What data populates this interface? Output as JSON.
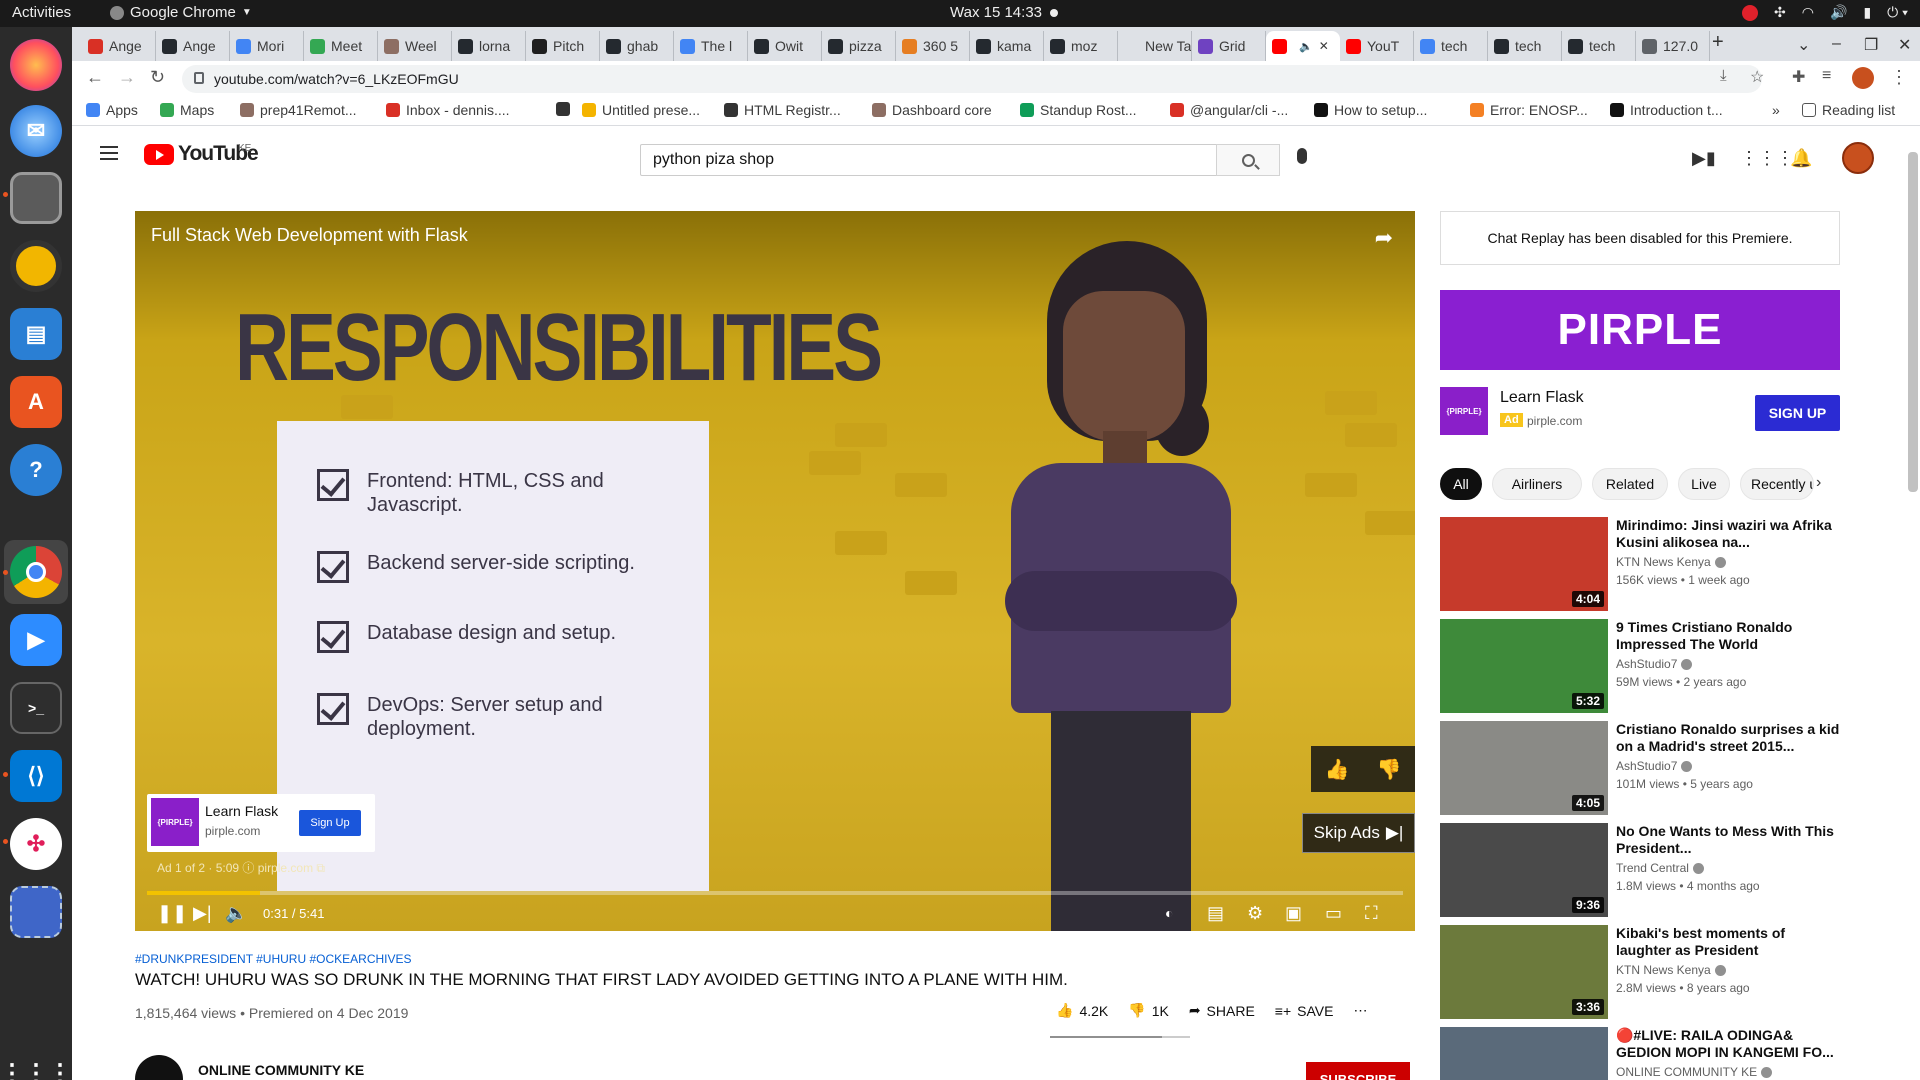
{
  "os": {
    "activities": "Activities",
    "app_name": "Google Chrome",
    "clock": "Wax 15  14:33"
  },
  "browser": {
    "tabs": [
      {
        "label": "Ange",
        "color": "#d93025"
      },
      {
        "label": "Ange",
        "color": "#24292f"
      },
      {
        "label": "Mori",
        "color": "#4285f4"
      },
      {
        "label": "Meet",
        "color": "#34a853"
      },
      {
        "label": "Weel",
        "color": "#8d6e63"
      },
      {
        "label": "lorna",
        "color": "#24292f"
      },
      {
        "label": "Pitch",
        "color": "#1f1f1f"
      },
      {
        "label": "ghab",
        "color": "#24292f"
      },
      {
        "label": "The l",
        "color": "#4285f4"
      },
      {
        "label": "Owit",
        "color": "#24292f"
      },
      {
        "label": "pizza",
        "color": "#24292f"
      },
      {
        "label": "360 5",
        "color": "#e67e22"
      },
      {
        "label": "kama",
        "color": "#24292f"
      },
      {
        "label": "moz",
        "color": "#24292f"
      },
      {
        "label": "New Tab",
        "color": "#dee1e6"
      },
      {
        "label": "Grid",
        "color": "#6f42c1"
      },
      {
        "label": "",
        "color": "#ff0000"
      },
      {
        "label": "YouT",
        "color": "#ff0000"
      },
      {
        "label": "tech",
        "color": "#4285f4"
      },
      {
        "label": "tech",
        "color": "#24292f"
      },
      {
        "label": "tech",
        "color": "#24292f"
      },
      {
        "label": "127.0",
        "color": "#5f6368"
      }
    ],
    "url": "youtube.com/watch?v=6_LKzEOFmGU",
    "bookmarks": [
      {
        "label": "Apps",
        "color": "#4285f4"
      },
      {
        "label": "Maps",
        "color": "#34a853"
      },
      {
        "label": "prep41Remot...",
        "color": "#8d6e63"
      },
      {
        "label": "Inbox - dennis....",
        "color": "#d93025"
      },
      {
        "label": "",
        "color": "#333333"
      },
      {
        "label": "Untitled prese...",
        "color": "#f4b400"
      },
      {
        "label": "HTML Registr...",
        "color": "#333333"
      },
      {
        "label": "Dashboard core",
        "color": "#8d6e63"
      },
      {
        "label": "Standup Rost...",
        "color": "#0f9d58"
      },
      {
        "label": "@angular/cli -...",
        "color": "#d93025"
      },
      {
        "label": "How to setup...",
        "color": "#111111"
      },
      {
        "label": "Error: ENOSP...",
        "color": "#f48024"
      },
      {
        "label": "Introduction t...",
        "color": "#111111"
      }
    ],
    "bookmarks_more": "»",
    "reading_list": "Reading list"
  },
  "youtube": {
    "logo_text": "YouTube",
    "country": "KE",
    "search_value": "python piza shop",
    "player": {
      "video_title": "Full Stack Web Development with Flask",
      "slide_heading": "RESPONSIBILITIES",
      "slide_items": [
        "Frontend: HTML, CSS and Javascript.",
        "Backend server-side scripting.",
        "Database design and setup.",
        "DevOps: Server setup and deployment."
      ],
      "ad_logo": "{PIRPLE}",
      "ad_title": "Learn Flask",
      "ad_domain": "pirple.com",
      "ad_button": "Sign Up",
      "ad_info": "Ad 1 of 2 · 5:09  ⓘ   pirple.com ⧉",
      "skip_label": "Skip Ads",
      "time": "0:31 / 5:41",
      "progress": 0.09
    },
    "video": {
      "hashtags": "#DRUNKPRESIDENT #UHURU #OCKEARCHIVES",
      "title": "WATCH! UHURU WAS SO DRUNK IN THE MORNING THAT FIRST LADY AVOIDED GETTING INTO A PLANE WITH HIM.",
      "meta": "1,815,464 views • Premiered on 4 Dec 2019",
      "likes": "4.2K",
      "dislikes": "1K",
      "share": "SHARE",
      "save": "SAVE",
      "like_ratio": 0.8,
      "channel": "ONLINE COMMUNITY KE",
      "subscribe": "SUBSCRIBE"
    },
    "sidebar": {
      "chat_replay": "Chat Replay has been disabled for this Premiere.",
      "banner": "PIRPLE",
      "ad_logo": "{PIRPLE}",
      "ad_title": "Learn Flask",
      "ad_badge": "Ad",
      "ad_domain": "pirple.com",
      "ad_button": "SIGN UP",
      "chips": [
        "All",
        "Airliners",
        "Related",
        "Live",
        "Recently uploaded"
      ],
      "recommendations": [
        {
          "title": "Mirindimo: Jinsi waziri wa Afrika Kusini alikosea na...",
          "channel": "KTN News Kenya",
          "meta": "156K views • 1 week ago",
          "duration": "4:04",
          "thumb": "#c63a2b"
        },
        {
          "title": "9 Times Cristiano Ronaldo Impressed The World",
          "channel": "AshStudio7",
          "meta": "59M views • 2 years ago",
          "duration": "5:32",
          "thumb": "#3e8a3a"
        },
        {
          "title": "Cristiano Ronaldo surprises a kid on a Madrid's street 2015...",
          "channel": "AshStudio7",
          "meta": "101M views • 5 years ago",
          "duration": "4:05",
          "thumb": "#8a8a86"
        },
        {
          "title": "No One Wants to Mess With This President...",
          "channel": "Trend Central",
          "meta": "1.8M views • 4 months ago",
          "duration": "9:36",
          "thumb": "#4a4a4a"
        },
        {
          "title": "Kibaki's best moments of laughter as President",
          "channel": "KTN News Kenya",
          "meta": "2.8M views • 8 years ago",
          "duration": "3:36",
          "thumb": "#6c7a3c"
        },
        {
          "title": "🔴#LIVE: RAILA ODINGA& GEDION MOPI IN KANGEMI FO...",
          "channel": "ONLINE COMMUNITY KE",
          "meta": "",
          "duration": "",
          "thumb": "#5a6a7a"
        }
      ]
    }
  }
}
